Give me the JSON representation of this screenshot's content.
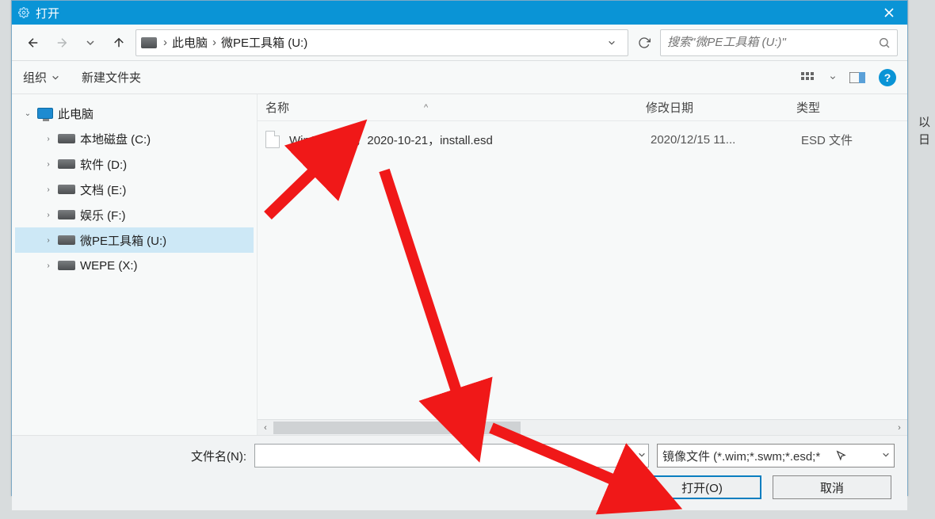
{
  "window": {
    "title": "打开",
    "close_tooltip": "关闭"
  },
  "nav": {
    "breadcrumb_root_icon": "drive-icon",
    "breadcrumb": [
      "此电脑",
      "微PE工具箱 (U:)"
    ],
    "search_placeholder": "搜索\"微PE工具箱 (U:)\""
  },
  "cmdbar": {
    "organize": "组织",
    "newfolder": "新建文件夹"
  },
  "tree": {
    "root": "此电脑",
    "drives": [
      {
        "label": "本地磁盘 (C:)",
        "selected": false
      },
      {
        "label": "软件 (D:)",
        "selected": false
      },
      {
        "label": "文档 (E:)",
        "selected": false
      },
      {
        "label": "娱乐 (F:)",
        "selected": false
      },
      {
        "label": "微PE工具箱 (U:)",
        "selected": true
      },
      {
        "label": "WEPE (X:)",
        "selected": false
      }
    ]
  },
  "list": {
    "columns": {
      "name": "名称",
      "date": "修改日期",
      "type": "类型"
    },
    "rows": [
      {
        "name": "Win10-20H2，2020-10-21，install.esd",
        "date": "2020/12/15 11...",
        "type": "ESD 文件"
      }
    ]
  },
  "footer": {
    "filename_label": "文件名(N):",
    "filename_value": "",
    "filter_value": "镜像文件 (*.wim;*.swm;*.esd;*",
    "open_btn": "打开(O)",
    "cancel_btn": "取消"
  },
  "right_clip": "以\n日"
}
